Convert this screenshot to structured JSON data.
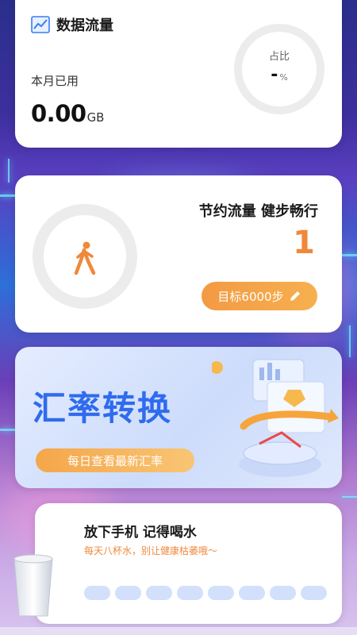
{
  "data_card": {
    "title": "数据流量",
    "month_label": "本月已用",
    "usage_value": "0.00",
    "usage_unit": "GB",
    "ring_label": "占比",
    "ring_value": "-",
    "ring_unit": "%",
    "ring_color": "#ececec"
  },
  "steps_card": {
    "title": "节约流量 健步畅行",
    "count": "1",
    "goal_label": "目标6000步",
    "accent_color": "#f0883a"
  },
  "exchange_card": {
    "title": "汇率转换",
    "subtitle": "每日查看最新汇率",
    "title_color": "#2f6bee"
  },
  "water_card": {
    "title": "放下手机 记得喝水",
    "subtitle": "每天八杯水，别让健康枯萎哦～",
    "cups_total": 8,
    "cups_filled": 0
  }
}
